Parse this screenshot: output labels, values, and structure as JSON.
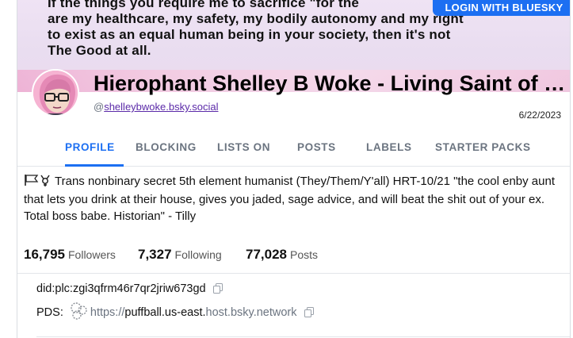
{
  "banner": {
    "quote": "If the things you require me to sacrifice \"for the\nare my healthcare, my safety, my bodily autonomy and my right\nto exist as an equal human being in your society, then it's not\nThe Good at all."
  },
  "header": {
    "login_label": "LOGIN WITH BLUESKY"
  },
  "profile": {
    "display_name": "Hierophant Shelley B Woke - Living Saint of Blasphemy",
    "handle_prefix": "@",
    "handle": "shelleybwoke.bsky.social",
    "joined": "6/22/2023",
    "description_flags": "🏳️‍⚧️",
    "description": "Trans nonbinary secret 5th element humanist (They/Them/Y'all) HRT-10/21 \"the cool enby aunt that lets you drink at their house, gives you jaded, sage advice, and will beat the shit out of your ex. Total boss babe. Historian\" - Tilly"
  },
  "tabs": [
    {
      "label": "PROFILE",
      "active": true
    },
    {
      "label": "BLOCKING"
    },
    {
      "label": "LISTS ON"
    },
    {
      "label": "POSTS"
    },
    {
      "label": "LABELS"
    },
    {
      "label": "STARTER PACKS"
    }
  ],
  "stats": {
    "followers_count": "16,795",
    "followers_label": "Followers",
    "following_count": "7,327",
    "following_label": "Following",
    "posts_count": "77,028",
    "posts_label": "Posts"
  },
  "details": {
    "did": "did:plc:zgi3qfrm46r7qr2jriw673gd",
    "pds_label": "PDS:",
    "pds_url_prefix": "https://",
    "pds_url_main": "puffball.us-east.",
    "pds_url_host": "host.bsky.network"
  },
  "colors": {
    "accent": "#1c6ff2",
    "handle_link": "#5b2aa8",
    "muted": "#6b7480"
  }
}
